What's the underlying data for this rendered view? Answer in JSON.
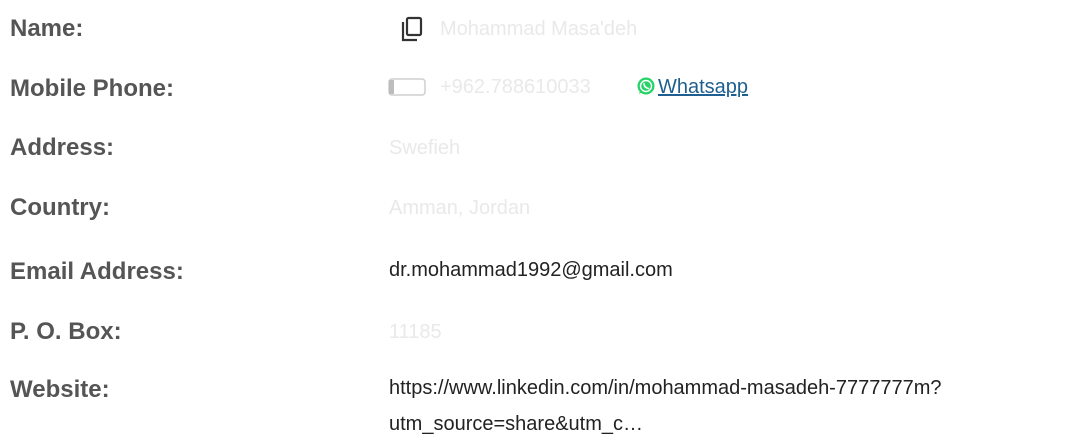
{
  "contact": {
    "name": {
      "label": "Name:",
      "value": "Mohammad Masa'deh",
      "icon": "copy-icon"
    },
    "mobile": {
      "label": "Mobile Phone:",
      "value": "+962.788610033",
      "icon": "phone-icon",
      "whatsapp_icon": "whatsapp-icon",
      "whatsapp_label": "Whatsapp",
      "whatsapp_color": "#25D366",
      "link_color": "#1f5f8f"
    },
    "address": {
      "label": "Address:",
      "value": "Swefieh"
    },
    "country": {
      "label": "Country:",
      "value": "Amman, Jordan"
    },
    "email": {
      "label": "Email Address:",
      "value": "dr.mohammad1992@gmail.com"
    },
    "po_box": {
      "label": "P. O. Box:",
      "value": "11185"
    },
    "website": {
      "label": "Website:",
      "value_line1": "https://www.linkedin.com/in/mohammad-masadeh-7777777m?",
      "value_line2": "utm_source=share&utm_c…"
    }
  },
  "colors": {
    "label_text": "#555555",
    "faint_value_text": "#e9e9e9",
    "dark_value_text": "#222222"
  }
}
